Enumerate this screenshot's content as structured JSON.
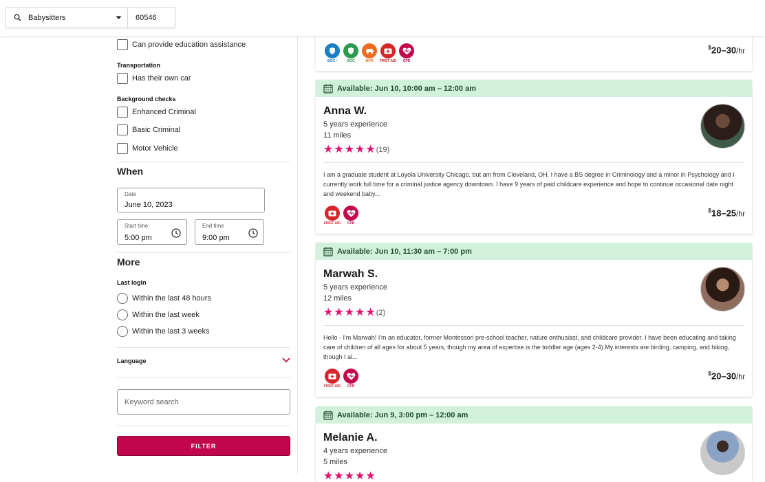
{
  "search": {
    "service": "Babysitters",
    "zip": "60546"
  },
  "filters": {
    "education_label": "Can provide education assistance",
    "transportation_heading": "Transportation",
    "own_car_label": "Has their own car",
    "background_heading": "Background checks",
    "background_items": [
      "Enhanced Criminal",
      "Basic Criminal",
      "Motor Vehicle"
    ],
    "when_heading": "When",
    "date_label": "Date",
    "date_value": "June 10, 2023",
    "start_label": "Start time",
    "start_value": "5:00 pm",
    "end_label": "End time",
    "end_value": "9:00 pm",
    "more_heading": "More",
    "last_login_heading": "Last login",
    "last_login_options": [
      "Within the last 48 hours",
      "Within the last week",
      "Within the last 3 weeks"
    ],
    "language_label": "Language",
    "keyword_placeholder": "Keyword search",
    "filter_button": "FILTER"
  },
  "top_card": {
    "badges": [
      "BGC+",
      "BGC",
      "MVR",
      "FIRST AID",
      "CPR"
    ],
    "price_dollar": "$",
    "price_range": "20–30",
    "price_unit": "/hr"
  },
  "cards": [
    {
      "availability": "Available: Jun 10, 10:00 am – 12:00 am",
      "name": "Anna W.",
      "experience": "5 years experience",
      "distance": "11 miles",
      "rating_count": "(19)",
      "bio": "I am a graduate student at Loyola University Chicago, but am from Cleveland, OH. I have a BS degree in Criminology and a minor in Psychology and I currently work full time for a criminal justice agency downtown. I have 9 years of paid childcare experience and hope to continue occasional date night and weekend baby...",
      "badges": [
        "FIRST AID",
        "CPR"
      ],
      "price_dollar": "$",
      "price_range": "18–25",
      "price_unit": "/hr"
    },
    {
      "availability": "Available: Jun 10, 11:30 am – 7:00 pm",
      "name": "Marwah S.",
      "experience": "5 years experience",
      "distance": "12 miles",
      "rating_count": "(2)",
      "bio": "Hello - I'm Marwah! I'm an educator, former Montessori pre-school teacher, nature enthusiast, and childcare provider. I have been educating and taking care of children of all ages for about 5 years, though my area of expertise is the toddler age (ages 2-4).My interests are birding, camping, and hiking, though I al...",
      "badges": [
        "FIRST AID",
        "CPR"
      ],
      "price_dollar": "$",
      "price_range": "20–30",
      "price_unit": "/hr"
    },
    {
      "availability": "Available: Jun 9, 3:00 pm – 12:00 am",
      "name": "Melanie A.",
      "experience": "4 years experience",
      "distance": "5 miles"
    }
  ],
  "colors": {
    "accent": "#c2064c",
    "star": "#e5106d",
    "availability_bg": "#d2f1dc",
    "badge_bgc_plus": "#1c7fc4",
    "badge_bgc": "#2e9a4f",
    "badge_mvr": "#ef6b1f",
    "badge_first_aid": "#d5262a",
    "badge_cpr": "#c2064c"
  }
}
